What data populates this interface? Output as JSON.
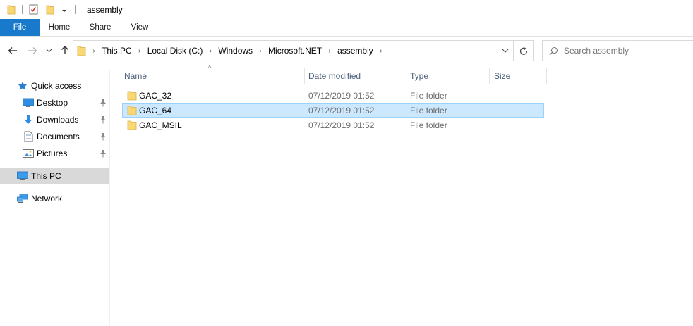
{
  "window": {
    "title": "assembly"
  },
  "ribbon": {
    "tabs": [
      {
        "label": "File"
      },
      {
        "label": "Home"
      },
      {
        "label": "Share"
      },
      {
        "label": "View"
      }
    ]
  },
  "address": {
    "crumbs": [
      "This PC",
      "Local Disk (C:)",
      "Windows",
      "Microsoft.NET",
      "assembly"
    ]
  },
  "search": {
    "placeholder": "Search assembly"
  },
  "nav": {
    "quick_access": "Quick access",
    "items": [
      {
        "label": "Desktop",
        "icon": "desktop-icon",
        "pinned": true
      },
      {
        "label": "Downloads",
        "icon": "downloads-icon",
        "pinned": true
      },
      {
        "label": "Documents",
        "icon": "documents-icon",
        "pinned": true
      },
      {
        "label": "Pictures",
        "icon": "pictures-icon",
        "pinned": true
      }
    ],
    "this_pc": "This PC",
    "network": "Network"
  },
  "columns": {
    "name": "Name",
    "date": "Date modified",
    "type": "Type",
    "size": "Size"
  },
  "files": [
    {
      "name": "GAC_32",
      "date": "07/12/2019 01:52",
      "type": "File folder",
      "selected": false
    },
    {
      "name": "GAC_64",
      "date": "07/12/2019 01:52",
      "type": "File folder",
      "selected": true
    },
    {
      "name": "GAC_MSIL",
      "date": "07/12/2019 01:52",
      "type": "File folder",
      "selected": false
    }
  ],
  "colors": {
    "file_tab": "#1979ca",
    "selection_bg": "#cce8ff",
    "selection_border": "#99d1ff",
    "folder_yellow": "#f8d775",
    "header_text": "#4c607a"
  }
}
